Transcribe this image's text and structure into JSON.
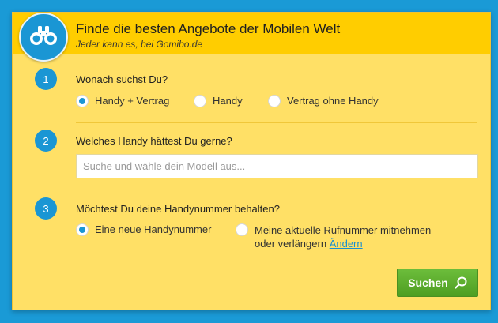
{
  "header": {
    "title": "Finde die besten Angebote der Mobilen Welt",
    "subtitle": "Jeder kann es, bei Gomibo.de",
    "logo_icon": "binoculars-icon"
  },
  "steps": [
    {
      "number": "1",
      "question": "Wonach suchst Du?",
      "options": [
        {
          "label": "Handy + Vertrag",
          "checked": true
        },
        {
          "label": "Handy",
          "checked": false
        },
        {
          "label": "Vertrag ohne Handy",
          "checked": false
        }
      ]
    },
    {
      "number": "2",
      "question": "Welches Handy hättest Du gerne?",
      "input": {
        "placeholder": "Suche und wähle dein Modell aus...",
        "value": ""
      }
    },
    {
      "number": "3",
      "question": "Möchtest Du deine Handynummer behalten?",
      "options": [
        {
          "label": "Eine neue Handynummer",
          "checked": true
        },
        {
          "label_line1": "Meine aktuelle Rufnummer mitnehmen",
          "label_line2": "oder verlängern",
          "link": "Ändern",
          "checked": false
        }
      ]
    }
  ],
  "submit": {
    "label": "Suchen",
    "icon": "search-icon"
  },
  "colors": {
    "background": "#1a9ad6",
    "panel": "#ffe066",
    "header": "#ffcd00",
    "accent_blue": "#1a96d4",
    "button_green": "#5fb12e"
  }
}
